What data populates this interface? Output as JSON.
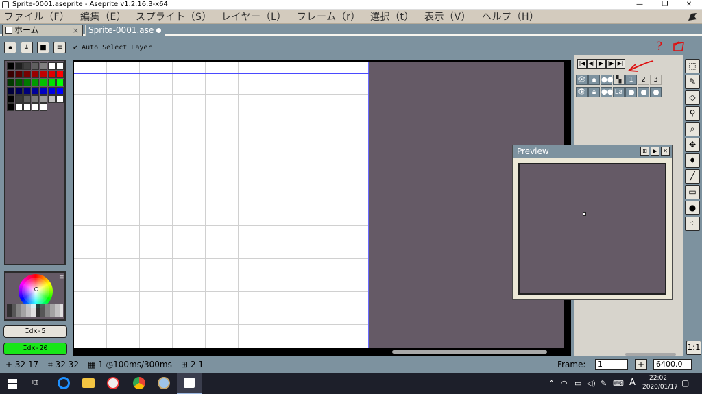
{
  "window": {
    "title": "Sprite-0001.aseprite - Aseprite v1.2.16.3-x64",
    "controls": [
      "—",
      "❐",
      "✕"
    ]
  },
  "menu": {
    "items": [
      "ファイル（F）",
      "編集（E）",
      "スプライト（S）",
      "レイヤー（L）",
      "フレーム（r）",
      "選択（t）",
      "表示（V）",
      "ヘルプ（H）"
    ]
  },
  "tabs": {
    "home": "ホーム",
    "home_close": "×",
    "sprite": "Sprite-0001.ase"
  },
  "toolbar": {
    "auto_select": "Auto Select Layer"
  },
  "palette": {
    "swatches": [
      [
        "#000000",
        "#1f1f1f",
        "#3f3f3f",
        "#5f5f5f",
        "#7f7f7f",
        "#ffffff",
        "#ffffff"
      ],
      [
        "#3a0000",
        "#5a0000",
        "#7a0000",
        "#9a0000",
        "#c00000",
        "#e00000",
        "#ff0000"
      ],
      [
        "#003a00",
        "#005a00",
        "#007a00",
        "#009a00",
        "#00c000",
        "#00e000",
        "#00ff00"
      ],
      [
        "#00003a",
        "#00005a",
        "#00007a",
        "#00009a",
        "#0000c0",
        "#0000e0",
        "#0000ff"
      ],
      [
        "#000000",
        "#3a3a3a",
        "#5a5a5a",
        "#7a7a7a",
        "#9a9a9a",
        "#c0c0c0",
        "#ffffff"
      ],
      [
        "#000000",
        "#ffffff",
        "#ffffff",
        "#ffffff",
        "#ffffff"
      ]
    ]
  },
  "colors": {
    "fg_index": "Idx-5",
    "bg_index": "Idx-20",
    "bg_index_color": "#18e618"
  },
  "timeline": {
    "frames": [
      "1",
      "2",
      "3"
    ],
    "layer_label": "La"
  },
  "preview": {
    "title": "Preview"
  },
  "status": {
    "coords": "32 17",
    "size": "32 32",
    "duration": "100ms/300ms",
    "grid": "2 1",
    "frame_label": "Frame:",
    "frame_value": "1",
    "plus": "+",
    "zoom": "6400.0",
    "ratio": "1:1"
  },
  "tray": {
    "time": "22:02",
    "date": "2020/01/17",
    "ime": "A"
  },
  "annotation": {
    "question": "?"
  }
}
